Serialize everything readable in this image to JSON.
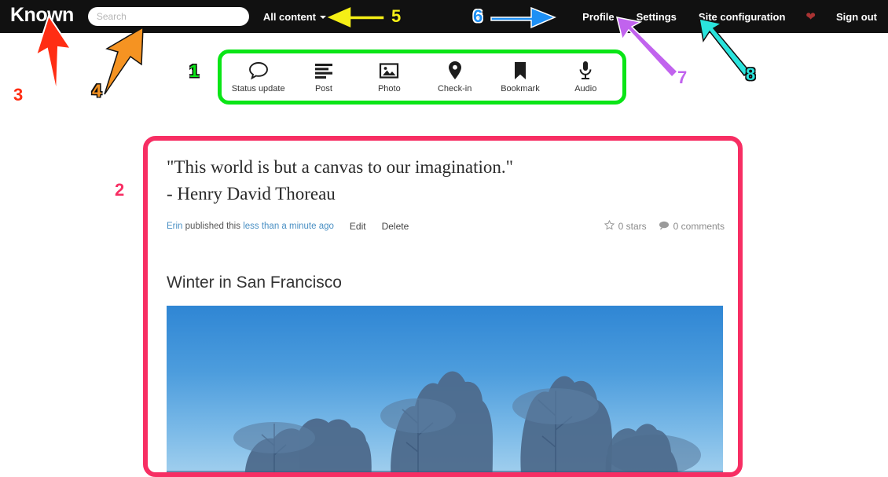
{
  "header": {
    "brand": "Known",
    "search": {
      "placeholder": "Search",
      "value": ""
    },
    "content_filter": {
      "label": "All content"
    },
    "links": [
      {
        "name": "profile",
        "label": "Profile"
      },
      {
        "name": "settings",
        "label": "Settings"
      },
      {
        "name": "site-configuration",
        "label": "Site configuration"
      }
    ],
    "heart_icon": "heart-icon",
    "heart_color": "#a33333",
    "signout": "Sign out",
    "background": "#111111"
  },
  "toolbar": {
    "items": [
      {
        "icon": "speech-bubble-icon",
        "label": "Status update"
      },
      {
        "icon": "text-lines-icon",
        "label": "Post"
      },
      {
        "icon": "photo-icon",
        "label": "Photo"
      },
      {
        "icon": "map-pin-icon",
        "label": "Check-in"
      },
      {
        "icon": "bookmark-icon",
        "label": "Bookmark"
      },
      {
        "icon": "microphone-icon",
        "label": "Audio"
      }
    ]
  },
  "stream": {
    "posts": [
      {
        "type": "quote",
        "line1": "\"This world is but a canvas to our imagination.\"",
        "line2": "- Henry David Thoreau",
        "author": "Erin",
        "published_text": "published this",
        "timestamp": "less than a minute ago",
        "edit_label": "Edit",
        "delete_label": "Delete",
        "stars": "0 stars",
        "comments": "0 comments"
      },
      {
        "type": "photo",
        "title": "Winter in San Francisco",
        "image_alt": "Blue sky with tree tops"
      }
    ]
  },
  "annotations": [
    {
      "id": "1",
      "color": "#0ae516",
      "target": "content-type-toolbar",
      "shape": "rounded-box"
    },
    {
      "id": "2",
      "color": "#f72e63",
      "target": "post-stream",
      "shape": "rounded-box"
    },
    {
      "id": "3",
      "color": "#ff2d13",
      "target": "brand-logo",
      "shape": "arrow-up"
    },
    {
      "id": "4",
      "color": "#f59322",
      "target": "search-input",
      "shape": "arrow-up-right"
    },
    {
      "id": "5",
      "color": "#f5ef16",
      "target": "all-content-filter",
      "shape": "arrow-left"
    },
    {
      "id": "6",
      "color": "#1e90f5",
      "target": "profile-link",
      "shape": "arrow-right"
    },
    {
      "id": "7",
      "color": "#c163ee",
      "target": "settings-link",
      "shape": "arrow-up-left"
    },
    {
      "id": "8",
      "color": "#2ae4dd",
      "target": "site-configuration-link",
      "shape": "arrow-up-left"
    }
  ]
}
